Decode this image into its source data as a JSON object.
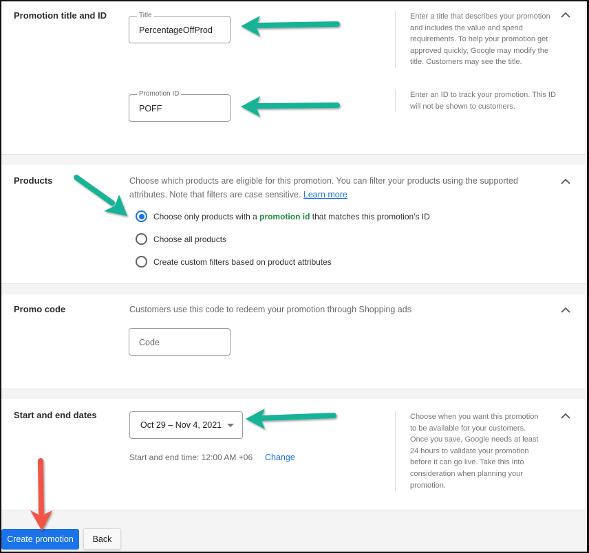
{
  "sections": {
    "title_id": {
      "label": "Promotion title and ID",
      "title_field": {
        "label": "Title",
        "value": "PercentageOffProd"
      },
      "id_field": {
        "label": "Promotion ID",
        "value": "POFF"
      },
      "title_help": "Enter a title that describes your promotion and includes the value and spend requirements. To help your promotion get approved quickly, Google may modify the title. Customers may see the title.",
      "id_help": "Enter an ID to track your promotion. This ID will not be shown to customers."
    },
    "products": {
      "label": "Products",
      "description": "Choose which products are eligible for this promotion. You can filter your products using the supported attributes. Note that filters are case sensitive.",
      "learn_more": "Learn more",
      "options": [
        {
          "prefix": "Choose only products with a ",
          "highlight": "promotion id",
          "suffix": " that matches this promotion's ID",
          "checked": true
        },
        {
          "prefix": "Choose all products",
          "highlight": "",
          "suffix": "",
          "checked": false
        },
        {
          "prefix": "Create custom filters based on product attributes",
          "highlight": "",
          "suffix": "",
          "checked": false
        }
      ]
    },
    "promo_code": {
      "label": "Promo code",
      "description": "Customers use this code to redeem your promotion through Shopping ads",
      "placeholder": "Code",
      "value": ""
    },
    "dates": {
      "label": "Start and end dates",
      "date_range": "Oct 29 – Nov 4, 2021",
      "time_text": "Start and end time: 12:00 AM +06",
      "change_link": "Change",
      "help": "Choose when you want this promotion to be available for your customers. Once you save, Google needs at least 24 hours to validate your promotion before it can go live. Take this into consideration when planning your promotion."
    }
  },
  "footer": {
    "create_label": "Create promotion",
    "back_label": "Back"
  },
  "icons": {
    "collapse": "chevron-up-icon",
    "dropdown": "caret-down-icon",
    "annotation_arrow_color": "#16b397",
    "annotation_arrow_red": "#f05545"
  },
  "colors": {
    "primary": "#1a73e8",
    "highlight_green": "#1e8e3e"
  }
}
